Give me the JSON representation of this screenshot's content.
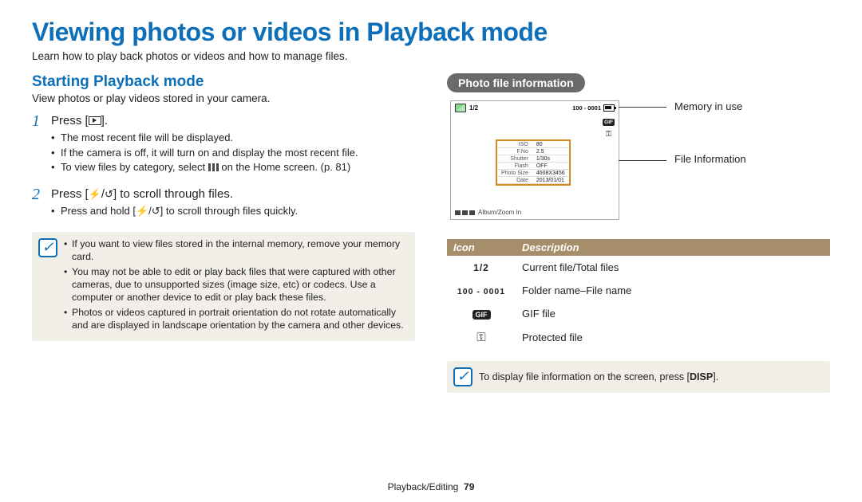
{
  "title": "Viewing photos or videos in Playback mode",
  "subtitle": "Learn how to play back photos or videos and how to manage files.",
  "left": {
    "heading": "Starting Playback mode",
    "intro": "View photos or play videos stored in your camera.",
    "step1": {
      "num": "1",
      "before": "Press [",
      "after": "].",
      "b1": "The most recent file will be displayed.",
      "b2": "If the camera is off, it will turn on and display the most recent file.",
      "b3_before": "To view files by category, select ",
      "b3_after": " on the Home screen. (p. 81)"
    },
    "step2": {
      "num": "2",
      "before": "Press [",
      "mid": "/",
      "after": "] to scroll through files.",
      "b1_before": "Press and hold [",
      "b1_mid": "/",
      "b1_after": "] to scroll through files quickly."
    },
    "note": {
      "n1": "If you want to view files stored in the internal memory, remove your memory card.",
      "n2": "You may not be able to edit or play back files that were captured with other cameras, due to unsupported sizes (image size, etc) or codecs. Use a computer or another device to edit or play back these files.",
      "n3": "Photos or videos captured in portrait orientation do not rotate automatically and are displayed in landscape orientation by the camera and other devices."
    }
  },
  "right": {
    "pill": "Photo file information",
    "screen": {
      "counter": "1/2",
      "filenum": "100 - 0001",
      "bottom": "Album/Zoom In",
      "info": {
        "r1k": "ISO",
        "r1v": "80",
        "r2k": "F.No",
        "r2v": "2.5",
        "r3k": "Shutter",
        "r3v": "1/30s",
        "r4k": "Flash",
        "r4v": "OFF",
        "r5k": "Photo Size",
        "r5v": "4608X3456",
        "r6k": "Date",
        "r6v": "2013/01/01"
      }
    },
    "callouts": {
      "memory": "Memory in use",
      "fileinfo": "File Information"
    },
    "table": {
      "h1": "Icon",
      "h2": "Description",
      "r1i": "1/2",
      "r1d": "Current file/Total files",
      "r2i": "100 - 0001",
      "r2d": "Folder name–File name",
      "r3d": "GIF file",
      "r4d": "Protected file"
    },
    "note": {
      "before": "To display file information on the screen, press [",
      "disp": "DISP",
      "after": "]."
    }
  },
  "footer": {
    "section": "Playback/Editing",
    "page": "79"
  }
}
